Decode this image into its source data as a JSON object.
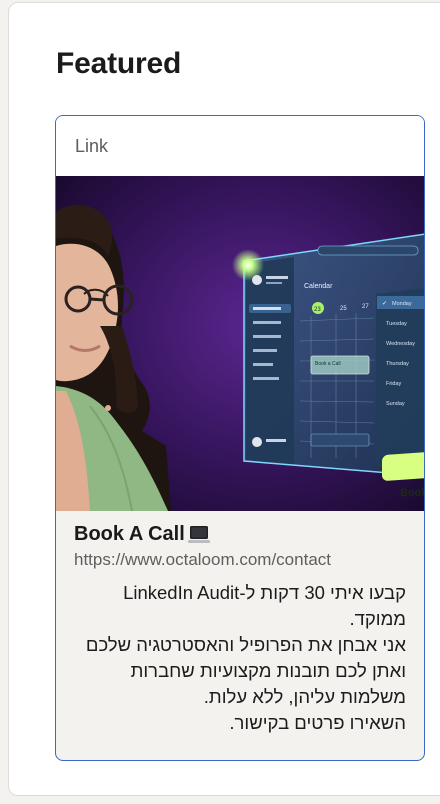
{
  "section": {
    "heading": "Featured"
  },
  "card": {
    "type_label": "Link",
    "title": "Book A Call",
    "title_icon": "laptop-icon",
    "url": "https://www.octaloom.com/contact",
    "description_lines": [
      "קבעו איתי 30 דקות ל-LinkedIn Audit ממוקד.",
      "אני אבחן את הפרופיל והאסטרטגיה שלכם ואתן לכם תובנות מקצועיות שחברות משלמות עליהן, ללא עלות.",
      "השאירו פרטים בקישור."
    ],
    "thumbnail": {
      "app_title": "Calendar",
      "days": [
        "Monday",
        "Tuesday",
        "Wednesday",
        "Thursday",
        "Friday",
        "Sunday"
      ],
      "book_button": "Book",
      "event_label": "Book a Call",
      "colors": {
        "bg": "#2a1247",
        "accent": "#a6f06b",
        "glass": "#35506e"
      }
    }
  }
}
